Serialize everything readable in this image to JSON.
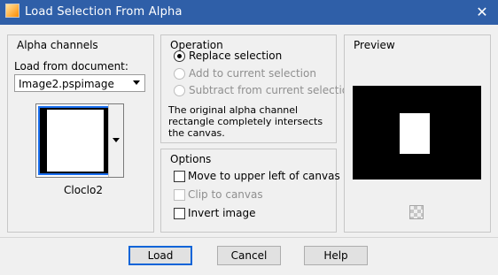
{
  "window": {
    "title": "Load Selection From Alpha",
    "close_glyph": "✕"
  },
  "alpha_channels": {
    "legend": "Alpha channels",
    "load_from_label": "Load from document:",
    "document_value": "Image2.pspimage",
    "channel_name": "Cloclo2"
  },
  "operation": {
    "legend": "Operation",
    "radios": [
      {
        "label": "Replace selection",
        "checked": true,
        "enabled": true
      },
      {
        "label": "Add to current selection",
        "checked": false,
        "enabled": false
      },
      {
        "label": "Subtract from current selection",
        "checked": false,
        "enabled": false
      }
    ],
    "description": "The original alpha channel rectangle completely intersects the canvas."
  },
  "options": {
    "legend": "Options",
    "checks": [
      {
        "label": "Move to upper left of canvas",
        "checked": false,
        "enabled": true
      },
      {
        "label": "Clip to canvas",
        "checked": false,
        "enabled": false
      },
      {
        "label": "Invert image",
        "checked": false,
        "enabled": true
      }
    ]
  },
  "preview": {
    "legend": "Preview",
    "transparency_icon": "checkerboard-icon"
  },
  "buttons": {
    "load": "Load",
    "cancel": "Cancel",
    "help": "Help"
  },
  "colors": {
    "titlebar": "#2f5fa8",
    "selection_border": "#1a6ff0",
    "default_button_border": "#0a64d8"
  }
}
